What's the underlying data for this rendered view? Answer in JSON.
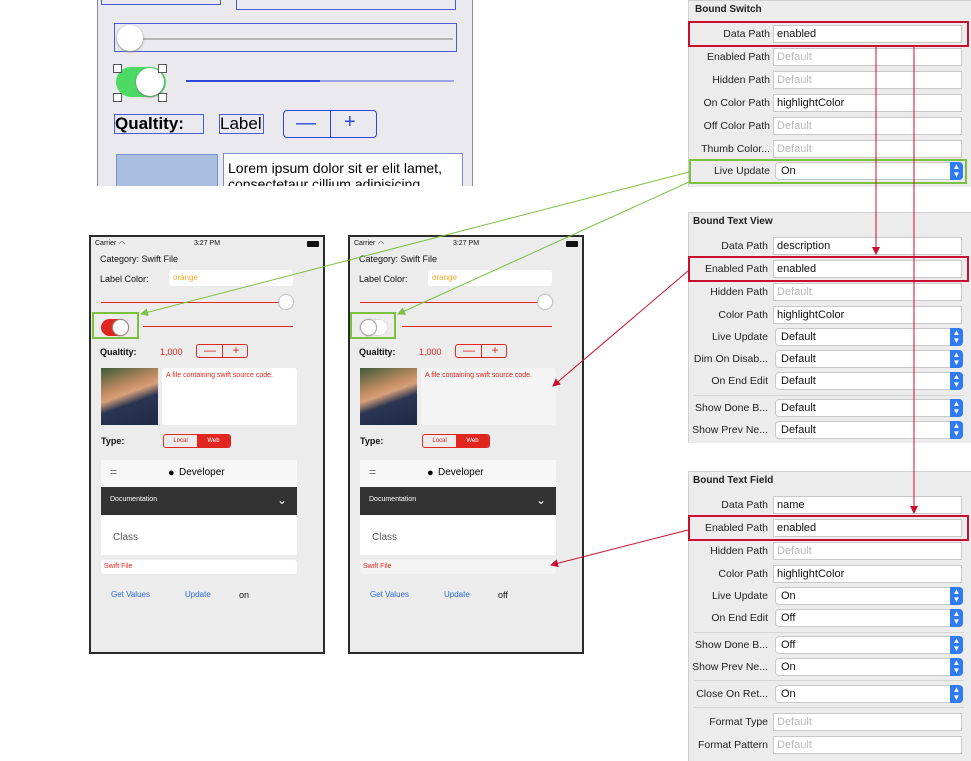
{
  "storyboard": {
    "quality_label": "Qualtity:",
    "label_text": "Label",
    "minus": "—",
    "plus": "+",
    "lorem": "Lorem ipsum dolor sit er elit lamet, consectetaur cillium adipisicing"
  },
  "phone_left": {
    "carrier": "Carrier",
    "time": "3:27 PM",
    "category": "Category: Swift File",
    "label_color_label": "Label Color:",
    "label_color_value": "orange",
    "quality_label": "Qualtity:",
    "quality_value": "1,000",
    "minus": "—",
    "plus": "+",
    "description": "A file containing swift source code.",
    "type_label": "Type:",
    "seg_local": "Local",
    "seg_web": "Web",
    "menu_icon": "=",
    "developer": "Developer",
    "documentation": "Documentation",
    "chevron": "⌄",
    "class_label": "Class",
    "name_field": "Swift File",
    "get_values": "Get Values",
    "update": "Update",
    "switch_state": "on"
  },
  "phone_right": {
    "carrier": "Carrier",
    "time": "3:27 PM",
    "category": "Category: Swift File",
    "label_color_label": "Label Color:",
    "label_color_value": "orange",
    "quality_label": "Qualtity:",
    "quality_value": "1,000",
    "minus": "—",
    "plus": "+",
    "description": "A file containing swift source code.",
    "type_label": "Type:",
    "seg_local": "Local",
    "seg_web": "Web",
    "menu_icon": "=",
    "developer": "Developer",
    "documentation": "Documentation",
    "chevron": "⌄",
    "class_label": "Class",
    "name_field": "Swift File",
    "get_values": "Get Values",
    "update": "Update",
    "switch_state": "off"
  },
  "bound_switch": {
    "title": "Bound Switch",
    "data_path_label": "Data Path",
    "data_path": "enabled",
    "enabled_path_label": "Enabled Path",
    "enabled_path_placeholder": "Default",
    "hidden_path_label": "Hidden Path",
    "hidden_path_placeholder": "Default",
    "on_color_path_label": "On Color Path",
    "on_color_path": "highlightColor",
    "off_color_path_label": "Off Color Path",
    "off_color_path_placeholder": "Default",
    "thumb_color_label": "Thumb Color...",
    "thumb_color_placeholder": "Default",
    "live_update_label": "Live Update",
    "live_update": "On"
  },
  "bound_text_view": {
    "title": "Bound Text View",
    "data_path_label": "Data Path",
    "data_path": "description",
    "enabled_path_label": "Enabled Path",
    "enabled_path": "enabled",
    "hidden_path_label": "Hidden Path",
    "hidden_path_placeholder": "Default",
    "color_path_label": "Color Path",
    "color_path": "highlightColor",
    "live_update_label": "Live Update",
    "live_update": "Default",
    "dim_on_disable_label": "Dim On Disab...",
    "dim_on_disable": "Default",
    "on_end_edit_label": "On End Edit",
    "on_end_edit": "Default",
    "show_done_label": "Show Done B...",
    "show_done": "Default",
    "show_prev_label": "Show Prev Ne...",
    "show_prev": "Default"
  },
  "bound_text_field": {
    "title": "Bound Text Field",
    "data_path_label": "Data Path",
    "data_path": "name",
    "enabled_path_label": "Enabled Path",
    "enabled_path": "enabled",
    "hidden_path_label": "Hidden Path",
    "hidden_path_placeholder": "Default",
    "color_path_label": "Color Path",
    "color_path": "highlightColor",
    "live_update_label": "Live Update",
    "live_update": "On",
    "on_end_edit_label": "On End Edit",
    "on_end_edit": "Off",
    "show_done_label": "Show Done B...",
    "show_done": "Off",
    "show_prev_label": "Show Prev Ne...",
    "show_prev": "On",
    "close_on_return_label": "Close On Ret...",
    "close_on_return": "On",
    "format_type_label": "Format Type",
    "format_type_placeholder": "Default",
    "format_pattern_label": "Format Pattern",
    "format_pattern_placeholder": "Default"
  },
  "colors": {
    "highlight_red": "#c8102e",
    "highlight_green": "#7ac142",
    "accent_red": "#e0261f",
    "ios_green": "#4cd964",
    "popup_blue": "#2f7bf5"
  },
  "icons": [
    "wifi-icon",
    "battery-icon",
    "apple-logo-icon",
    "hamburger-icon",
    "chevron-down-icon",
    "popup-chevron-icon"
  ]
}
